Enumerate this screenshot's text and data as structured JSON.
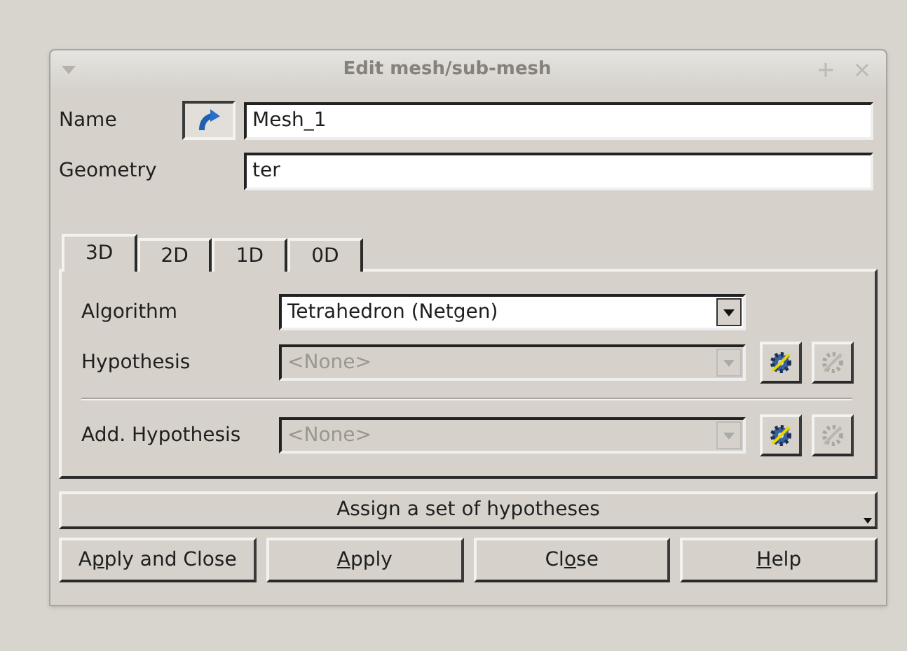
{
  "window": {
    "title": "Edit mesh/sub-mesh"
  },
  "name_field": {
    "label": "Name",
    "value": "Mesh_1"
  },
  "geometry_field": {
    "label": "Geometry",
    "value": "ter"
  },
  "tabs": [
    {
      "label": "3D",
      "selected": true
    },
    {
      "label": "2D",
      "selected": false
    },
    {
      "label": "1D",
      "selected": false
    },
    {
      "label": "0D",
      "selected": false
    }
  ],
  "rows": [
    {
      "label": "Algorithm",
      "value": "Tetrahedron (Netgen)",
      "disabled": false,
      "has_buttons": false
    },
    {
      "label": "Hypothesis",
      "value": "<None>",
      "disabled": true,
      "has_buttons": true,
      "edit_disabled": true
    },
    {
      "label": "Add. Hypothesis",
      "value": "<None>",
      "disabled": true,
      "has_buttons": true,
      "edit_disabled": true
    }
  ],
  "assign_button": "Assign a set of hypotheses",
  "buttons": [
    {
      "before": "A",
      "key": "p",
      "after": "ply and Close"
    },
    {
      "key": "A",
      "after": "pply"
    },
    {
      "before": "Cl",
      "key": "o",
      "after": "se"
    },
    {
      "key": "H",
      "after": "elp"
    }
  ]
}
